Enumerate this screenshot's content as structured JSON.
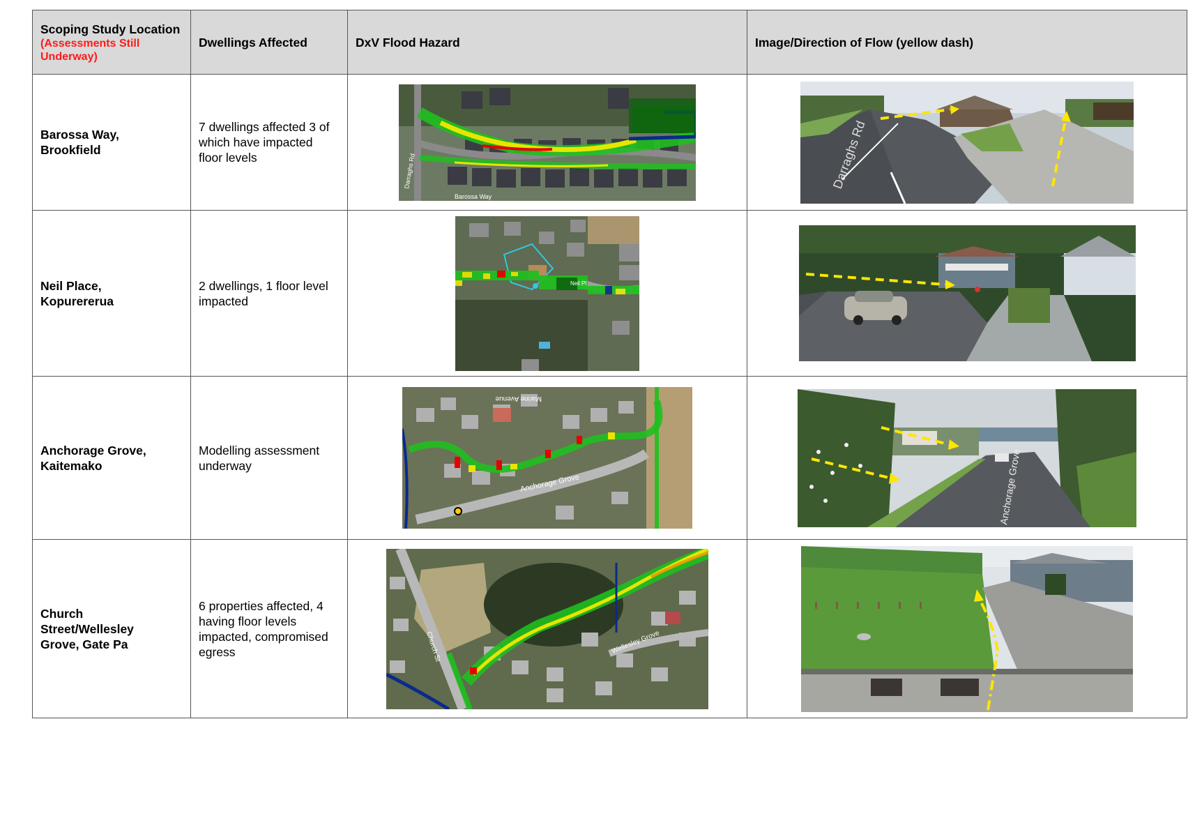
{
  "headers": {
    "location": "Scoping Study Location",
    "location_note": "(Assessments Still Underway)",
    "dwellings": "Dwellings Affected",
    "hazard": "DxV Flood Hazard",
    "flow": "Image/Direction of Flow (yellow dash)"
  },
  "rows": [
    {
      "location_line1": "Barossa Way,",
      "location_line2": "Brookfield",
      "dwellings": "7 dwellings affected 3 of which have impacted floor levels",
      "map_label": "Darraghs Rd",
      "map_label2": "Barossa Way",
      "photo_label": "Darraghs Rd"
    },
    {
      "location_line1": "Neil Place,",
      "location_line2": "Kopurererua",
      "dwellings": "2 dwellings, 1 floor level impacted",
      "map_label": "Neil Pl"
    },
    {
      "location_line1": "Anchorage Grove,",
      "location_line2": "Kaitemako",
      "dwellings": "Modelling assessment underway",
      "map_label": "Anchorage Grove",
      "map_label2": "Marine Avenue",
      "photo_label": "Anchorage Grove"
    },
    {
      "location_line1": "Church",
      "location_line2": "Street/Wellesley",
      "location_line3": "Grove, Gate Pa",
      "dwellings": "6 properties affected, 4 having floor levels impacted, compromised egress",
      "map_label": "Church St",
      "map_label2": "Wellesley Grove"
    }
  ],
  "colors": {
    "header_bg": "#d9d9d9",
    "note_red": "#ff1a1a",
    "flow_dash": "#ffe600",
    "hazard_low": "#1fbf1f",
    "hazard_mid": "#e6e600",
    "hazard_high": "#e60000",
    "hazard_deep": "#0a2a8a"
  }
}
